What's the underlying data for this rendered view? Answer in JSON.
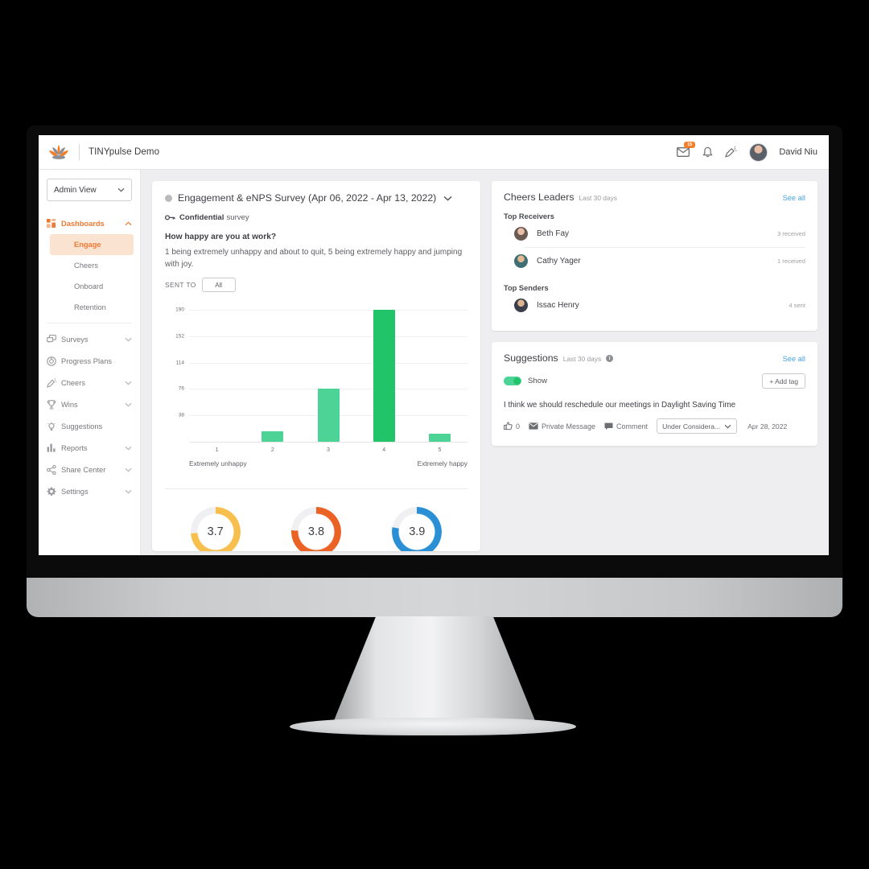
{
  "header": {
    "brand_name": "TINYpulse Demo",
    "logo_icon": "lotus-logo-icon",
    "mail_icon": "mail-icon",
    "mail_badge": "15",
    "bell_icon": "bell-icon",
    "cheers_icon": "megaphone-icon",
    "avatar_icon": "user-avatar",
    "user_name": "David Niu"
  },
  "sidebar": {
    "view_selector": {
      "label": "Admin View",
      "chevron": "chevron-down-icon"
    },
    "items": [
      {
        "label": "Dashboards",
        "icon": "grid-icon",
        "chevron": "chevron-up-icon",
        "active": true
      },
      {
        "label": "Surveys",
        "icon": "survey-icon",
        "chevron": "chevron-down-icon",
        "active": false
      },
      {
        "label": "Progress Plans",
        "icon": "target-icon",
        "chevron": "",
        "active": false
      },
      {
        "label": "Cheers",
        "icon": "megaphone-icon",
        "chevron": "chevron-down-icon",
        "active": false
      },
      {
        "label": "Wins",
        "icon": "trophy-icon",
        "chevron": "chevron-down-icon",
        "active": false
      },
      {
        "label": "Suggestions",
        "icon": "lightbulb-icon",
        "chevron": "",
        "active": false
      },
      {
        "label": "Reports",
        "icon": "bar-chart-icon",
        "chevron": "chevron-down-icon",
        "active": false
      },
      {
        "label": "Share Center",
        "icon": "share-icon",
        "chevron": "chevron-down-icon",
        "active": false
      },
      {
        "label": "Settings",
        "icon": "gear-icon",
        "chevron": "chevron-down-icon",
        "active": false
      }
    ],
    "sub_items": [
      {
        "label": "Engage",
        "selected": true
      },
      {
        "label": "Cheers",
        "selected": false
      },
      {
        "label": "Onboard",
        "selected": false
      },
      {
        "label": "Retention",
        "selected": false
      }
    ]
  },
  "survey": {
    "title": "Engagement & eNPS Survey (Apr 06, 2022 - Apr 13, 2022)",
    "status_dot": "status-dot-grey",
    "title_chevron": "chevron-down-icon",
    "confidential_icon": "key-icon",
    "confidential_strong": "Confidential",
    "confidential_rest": "survey",
    "question": "How happy are you at work?",
    "description": "1 being extremely unhappy and about to quit, 5 being extremely happy and jumping with joy.",
    "sent_to_label": "SENT TO",
    "sent_to_value": "All",
    "gauges": [
      {
        "value": "3.7",
        "color": "#f7bf4e",
        "percent": 74
      },
      {
        "value": "3.8",
        "color": "#ea6325",
        "percent": 76
      },
      {
        "value": "3.9",
        "color": "#2a8fd4",
        "percent": 78
      }
    ]
  },
  "chart_data": {
    "type": "bar",
    "title": "How happy are you at work?",
    "categories": [
      "1",
      "2",
      "3",
      "4",
      "5"
    ],
    "values": [
      0,
      15,
      77,
      190,
      12
    ],
    "colors": [
      "#4ed396",
      "#4ed396",
      "#4ed396",
      "#22c46a",
      "#4ed396"
    ],
    "xlabel": "",
    "ylabel": "",
    "ylim": [
      0,
      190
    ],
    "yticks": [
      38,
      76,
      114,
      152,
      190
    ],
    "grid": true,
    "legend": "none",
    "axis_start_label": "Extremely unhappy",
    "axis_end_label": "Extremely happy"
  },
  "cheers": {
    "title": "Cheers Leaders",
    "subtitle": "Last 30 days",
    "see_all": "See all",
    "receivers_label": "Top Receivers",
    "senders_label": "Top Senders",
    "receivers": [
      {
        "name": "Beth Fay",
        "count": "3 received",
        "avatar": "avatar-beth"
      },
      {
        "name": "Cathy Yager",
        "count": "1 received",
        "avatar": "avatar-cathy"
      }
    ],
    "senders": [
      {
        "name": "Issac Henry",
        "count": "4 sent",
        "avatar": "avatar-issac"
      }
    ]
  },
  "suggestions": {
    "title": "Suggestions",
    "subtitle": "Last 30 days",
    "info_icon": "info-icon",
    "info_glyph": "i",
    "see_all": "See all",
    "toggle_label": "Show",
    "add_tag": "+ Add tag",
    "text": "I think we should reschedule our meetings in Daylight Saving Time",
    "like_icon": "thumbs-up-icon",
    "like_count": "0",
    "private_message_icon": "mail-icon",
    "private_message": "Private Message",
    "comment_icon": "comment-icon",
    "comment": "Comment",
    "status_value": "Under Considera...",
    "status_chevron": "chevron-down-icon",
    "date": "Apr 28, 2022"
  }
}
